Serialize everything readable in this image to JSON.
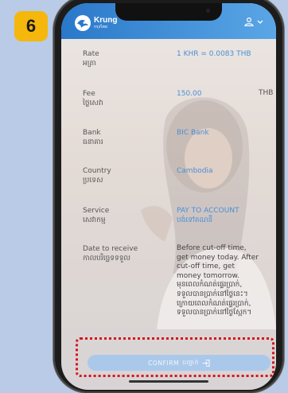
{
  "step_badge": "6",
  "header": {
    "logo_name": "Krung",
    "logo_sub": "กรุงไทย"
  },
  "details": [
    {
      "label": "Rate",
      "label_km": "អត្រា",
      "value": "1 KHR = 0.0083 THB",
      "unit": ""
    },
    {
      "label": "Fee",
      "label_km": "ថ្លៃសេវា",
      "value": "150.00",
      "unit": "THB"
    },
    {
      "label": "Bank",
      "label_km": "ធនាគារ",
      "value": "BIC Bank",
      "unit": ""
    },
    {
      "label": "Country",
      "label_km": "ប្រទេស",
      "value": "Cambodia",
      "unit": ""
    },
    {
      "label": "Service",
      "label_km": "សេវាកម្ម",
      "value": "PAY TO ACCOUNT",
      "value_km": "បង់ទៅគណនី",
      "unit": ""
    }
  ],
  "date_to_receive": {
    "label": "Date to receive",
    "label_km": "កាលបរិច្ឆេទទទួល",
    "lines": [
      "Before cut-off time,",
      "get money today. After",
      "cut-off time, get",
      "money tomorrow.",
      "មុនពេលកំណត់ផ្ទេរប្រាក់,",
      "ទទួលបានប្រាក់នៅថ្ងៃនេះ។",
      "ក្រោយពេលកំណត់ផ្ទេរប្រាក់,",
      "ទទួលបានប្រាក់នៅថ្ងៃស្អែក។"
    ]
  },
  "confirm_button": {
    "label": "CONFIRM",
    "label_km": "បញ្ជាក់"
  },
  "colors": {
    "header": "#3b8ad6",
    "value_text": "#4c8fd6",
    "highlight": "#d4161b",
    "badge": "#f5b70b"
  }
}
